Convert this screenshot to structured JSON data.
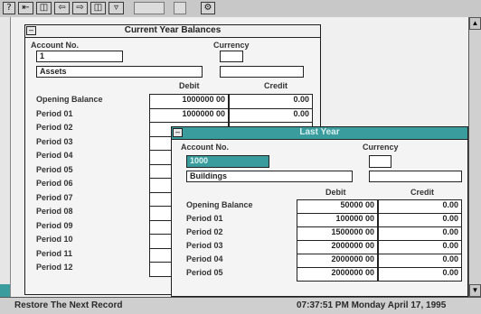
{
  "toolbar": {
    "buttons": [
      "?",
      "⇤",
      "◫",
      "⇦",
      "⇨",
      "◫",
      "▿",
      "",
      "",
      "⚙"
    ]
  },
  "status_bar": {
    "message": "Restore The Next Record",
    "datetime": "07:37:51 PM  Monday April 17, 1995"
  },
  "window_back": {
    "title": "Current Year Balances",
    "account_no_label": "Account No.",
    "currency_label": "Currency",
    "account_no_value": "1",
    "currency_value": "",
    "account_name": "Assets",
    "debit_label": "Debit",
    "credit_label": "Credit",
    "rows": [
      {
        "label": "Opening Balance",
        "debit": "1000000 00",
        "credit": "0.00"
      },
      {
        "label": "Period 01",
        "debit": "1000000 00",
        "credit": "0.00"
      },
      {
        "label": "Period 02",
        "debit": "",
        "credit": ""
      },
      {
        "label": "Period 03",
        "debit": "",
        "credit": ""
      },
      {
        "label": "Period 04",
        "debit": "",
        "credit": ""
      },
      {
        "label": "Period 05",
        "debit": "",
        "credit": ""
      },
      {
        "label": "Period 06",
        "debit": "",
        "credit": ""
      },
      {
        "label": "Period 07",
        "debit": "",
        "credit": ""
      },
      {
        "label": "Period 08",
        "debit": "",
        "credit": ""
      },
      {
        "label": "Period 09",
        "debit": "",
        "credit": ""
      },
      {
        "label": "Period 10",
        "debit": "",
        "credit": ""
      },
      {
        "label": "Period 11",
        "debit": "",
        "credit": ""
      },
      {
        "label": "Period 12",
        "debit": "",
        "credit": ""
      }
    ]
  },
  "window_front": {
    "title": "Last Year",
    "account_no_label": "Account No.",
    "currency_label": "Currency",
    "account_no_value": "1000",
    "currency_value": "",
    "account_name": "Buildings",
    "debit_label": "Debit",
    "credit_label": "Credit",
    "rows": [
      {
        "label": "Opening Balance",
        "debit": "50000 00",
        "credit": "0.00"
      },
      {
        "label": "Period 01",
        "debit": "100000 00",
        "credit": "0.00"
      },
      {
        "label": "Period 02",
        "debit": "1500000 00",
        "credit": "0.00"
      },
      {
        "label": "Period 03",
        "debit": "2000000 00",
        "credit": "0.00"
      },
      {
        "label": "Period 04",
        "debit": "2000000 00",
        "credit": "0.00"
      },
      {
        "label": "Period 05",
        "debit": "2000000 00",
        "credit": "0.00"
      }
    ]
  },
  "colors": {
    "accent": "#3a9c9c",
    "desktop": "#7e7e7e"
  }
}
